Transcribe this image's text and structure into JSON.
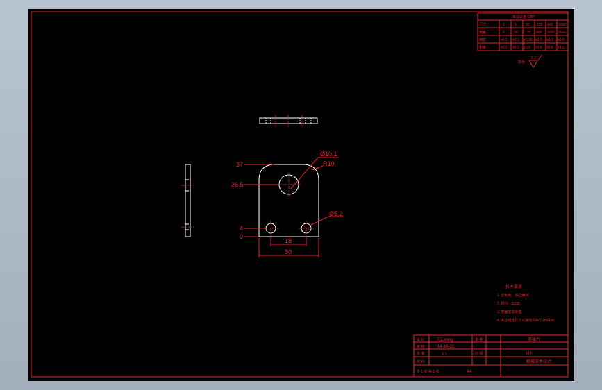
{
  "colors": {
    "background": "#000000",
    "frame": "#e8242a",
    "geometry": "#ffffff",
    "window": "#b3bfcc"
  },
  "dimensions": {
    "d_big_hole": "Ø10.1",
    "radius": "R10",
    "d_small_hole": "Ø5.2",
    "top_height": "37",
    "hole_height": "26.5",
    "small_hole_height": "4",
    "base": "0",
    "hole_spacing": "18",
    "width": "30"
  },
  "table_top": {
    "title": "未注公差 GB/T",
    "rows": [
      [
        "尺寸",
        "1",
        "6",
        "30",
        "120",
        "400",
        "1000"
      ],
      [
        "偏差",
        "6",
        "30",
        "120",
        "400",
        "1000",
        "2000"
      ],
      [
        "精密",
        "±0.1",
        "±0.1",
        "±0.15",
        "±0.2",
        "±0.3",
        "±0.5"
      ],
      [
        "中等",
        "±0.1",
        "±0.2",
        "±0.3",
        "±0.5",
        "±0.8",
        "±1.2"
      ]
    ]
  },
  "roughness": {
    "label": "其余",
    "value": "6.3"
  },
  "notes": {
    "title": "技术要求",
    "items": [
      "1. 去毛刺、锐边倒钝",
      "2. 材料：Q235",
      "3. 表面发黑处理",
      "4. 未注线性尺寸公差按 GB/T 1804-m"
    ]
  },
  "title_block": {
    "designer": "F.L.song",
    "date": "14-10-30",
    "scale": "1:1",
    "sheet": "A4",
    "part_name": "连接片",
    "code": "HY-",
    "company": "机械零件设计",
    "labels": {
      "design": "设 计",
      "check": "审 核",
      "approve": "批 准",
      "material": "材 料",
      "weight": "重 量",
      "scale": "比 例",
      "footer": "共 1 张 第 1 张"
    }
  }
}
